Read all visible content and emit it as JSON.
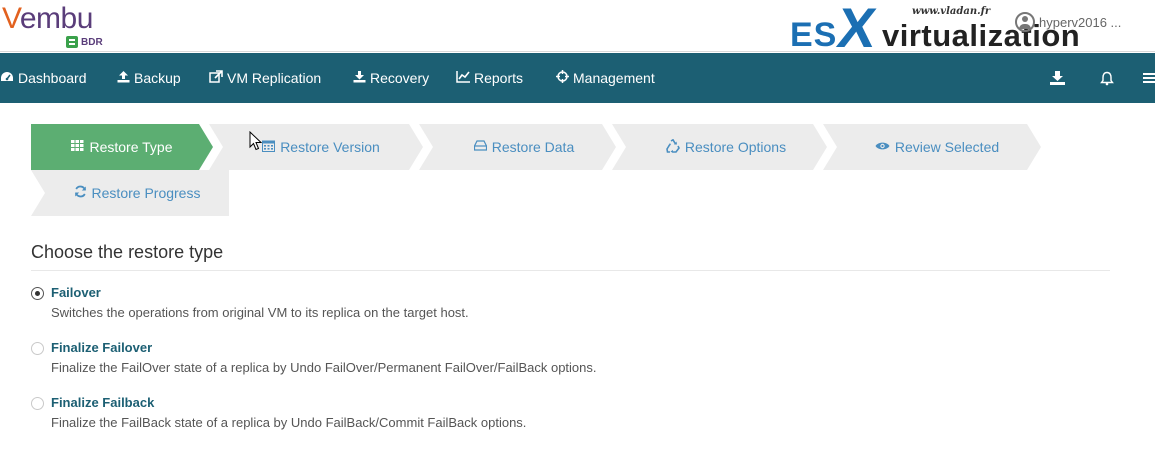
{
  "header": {
    "logo_text": "embu",
    "logo_v": "V",
    "logo_badge": "BDR",
    "watermark_site": "www.vladan.fr",
    "watermark_es": "ES",
    "watermark_x": "X",
    "watermark_virt": "virtualization",
    "user_text": "hyperv2016 ..."
  },
  "nav": {
    "items": [
      {
        "label": "Dashboard",
        "icon": "dashboard-icon"
      },
      {
        "label": "Backup",
        "icon": "upload-icon"
      },
      {
        "label": "VM Replication",
        "icon": "share-icon"
      },
      {
        "label": "Recovery",
        "icon": "download-icon"
      },
      {
        "label": "Reports",
        "icon": "line-chart-icon"
      },
      {
        "label": "Management",
        "icon": "crosshair-icon"
      }
    ],
    "right_icons": [
      "download-icon",
      "bell-icon",
      "menu-icon"
    ]
  },
  "wizard": {
    "steps": [
      {
        "label": "Restore Type",
        "icon": "grid-icon",
        "active": true
      },
      {
        "label": "Restore Version",
        "icon": "calendar-icon",
        "active": false
      },
      {
        "label": "Restore Data",
        "icon": "drive-icon",
        "active": false
      },
      {
        "label": "Restore Options",
        "icon": "recycle-icon",
        "active": false
      },
      {
        "label": "Review Selected",
        "icon": "eye-icon",
        "active": false
      },
      {
        "label": "Restore Progress",
        "icon": "refresh-icon",
        "active": false
      }
    ]
  },
  "content": {
    "title": "Choose the restore type",
    "options": [
      {
        "title": "Failover",
        "desc": "Switches the operations from original VM to its replica on the target host.",
        "selected": true
      },
      {
        "title": "Finalize Failover",
        "desc": "Finalize the FailOver state of a replica by Undo FailOver/Permanent FailOver/FailBack options.",
        "selected": false
      },
      {
        "title": "Finalize Failback",
        "desc": "Finalize the FailBack state of a replica by Undo FailBack/Commit FailBack options.",
        "selected": false
      }
    ]
  },
  "colors": {
    "nav_bg": "#1c5f73",
    "step_active": "#5cae72",
    "step_inactive": "#ececec",
    "link": "#4a8ec0"
  }
}
